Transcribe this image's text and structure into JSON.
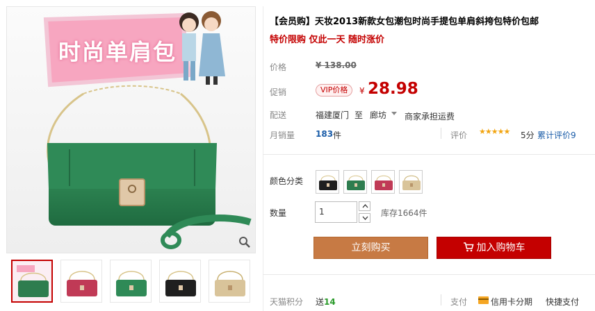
{
  "gallery": {
    "banner_text": "时尚单肩包",
    "thumb_count": 5,
    "thumb_colors": [
      "#2e7d4f",
      "#c03a56",
      "#2f8a57",
      "#1f1f1f",
      "#d9c49a"
    ]
  },
  "product": {
    "title": "【会员购】天妆2013新款女包潮包时尚手提包单肩斜挎包特价包邮",
    "subtitle": "特价限购 仅此一天 随时涨价"
  },
  "price": {
    "label": "价格",
    "original": "¥ 138.00",
    "promo_label": "促销",
    "vip_badge": "VIP价格",
    "currency": "¥",
    "current": "28.98"
  },
  "delivery": {
    "label": "配送",
    "from": "福建厦门",
    "to_word": "至",
    "city": "廊坊",
    "fee": "商家承担运费"
  },
  "sales": {
    "label": "月销量",
    "count": "183",
    "unit": "件",
    "rating_label": "评价",
    "stars": "★★★★★",
    "score": "5分",
    "reviews": "累计评价9"
  },
  "options": {
    "color_label": "颜色分类",
    "swatch_colors": [
      "#1f1f1f",
      "#2e7d4f",
      "#c03a56",
      "#d9c49a"
    ],
    "qty_label": "数量",
    "qty_value": "1",
    "stock": "库存1664件"
  },
  "actions": {
    "buy": "立刻购买",
    "cart": "加入购物车"
  },
  "footer": {
    "points_label": "天猫积分",
    "points_prefix": "送",
    "points_value": "14",
    "pay_label": "支付",
    "pay_card": "信用卡分期",
    "pay_fast": "快捷支付"
  },
  "colors": {
    "accent_red": "#c40000",
    "buy_orange": "#c77a44",
    "link_blue": "#1a5ca8",
    "star_gold": "#f2a512"
  }
}
